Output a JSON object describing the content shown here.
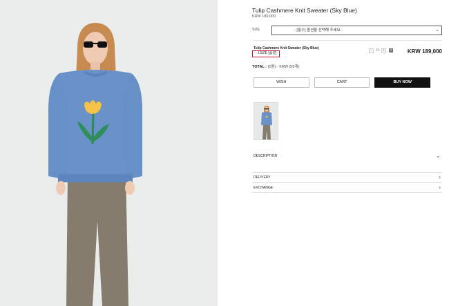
{
  "product": {
    "name": "Tulip Cashmere Knit Sweater (Sky Blue)",
    "price": "KRW 189,000"
  },
  "options": {
    "size_label": "SIZE",
    "size_placeholder": "- [필수] 옵션을 선택해 주세요 -"
  },
  "selected": {
    "name": "Tulip Cashmere Knit Sweater (Sky Blue)",
    "option": "- 1SIZE [품절]",
    "quantity": "0",
    "minus": "−",
    "plus": "+",
    "remove": "×",
    "price": "KRW 189,000"
  },
  "total": {
    "label": "TOTAL :",
    "value": "(0원) · KRW 0(0개)"
  },
  "buttons": {
    "wish": "WISH",
    "cart": "CART",
    "buy": "BUY NOW"
  },
  "sections": {
    "description": "DESCRIPTION",
    "delivery": "DELIVERY",
    "exchange": "EXCHANGE"
  },
  "icons": {
    "select_chevron": "chevron-down-icon",
    "expand": "chevron-down-icon",
    "next": "chevron-right-icon"
  },
  "colors": {
    "sweater": "#6b92c8",
    "highlight_border": "#c8102e",
    "buy_button": "#111111"
  }
}
